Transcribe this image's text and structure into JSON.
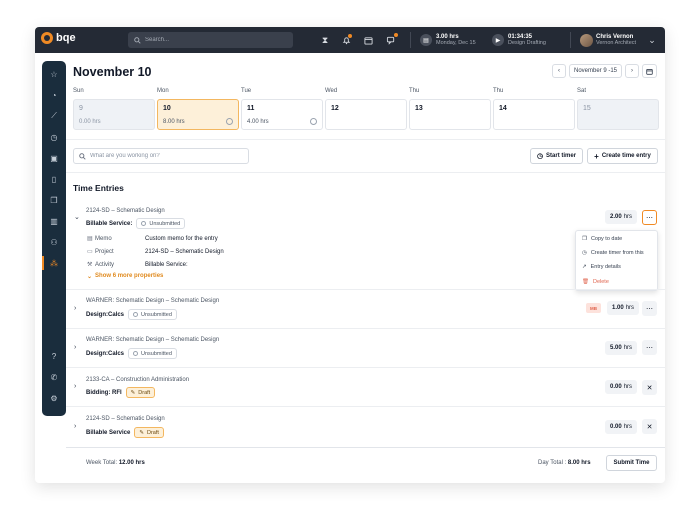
{
  "topbar": {
    "brand": "bqe",
    "search_placeholder": "Search...",
    "timer_hours": "3.00 hrs",
    "timer_date": "Monday, Dec 15",
    "running_time": "01:34:35",
    "running_activity": "Design Drafting",
    "user_name": "Chris Vernon",
    "user_role": "Vernon Architect"
  },
  "page": {
    "title": "November 10",
    "week_range": "November  9 -15"
  },
  "days": [
    {
      "label": "Sun",
      "num": "9",
      "hrs": "0.00 hrs",
      "state": "muted"
    },
    {
      "label": "Mon",
      "num": "10",
      "hrs": "8.00 hrs",
      "state": "selected"
    },
    {
      "label": "Tue",
      "num": "11",
      "hrs": "4.00 hrs",
      "state": "normal"
    },
    {
      "label": "Wed",
      "num": "12",
      "hrs": "",
      "state": "normal"
    },
    {
      "label": "Thu",
      "num": "13",
      "hrs": "",
      "state": "normal"
    },
    {
      "label": "Thu",
      "num": "14",
      "hrs": "",
      "state": "normal"
    },
    {
      "label": "Sat",
      "num": "15",
      "hrs": "",
      "state": "muted"
    }
  ],
  "actions": {
    "work_placeholder": "What are you working on?",
    "start_timer": "Start timer",
    "create_entry": "Create time entry"
  },
  "section_title": "Time Entries",
  "entries": [
    {
      "code": "2124-SD – Schematic Design",
      "service": "Billable Service:",
      "status": "Unsubmitted",
      "hours": "2.00",
      "unit": "hrs"
    },
    {
      "code": "WARNER: Schematic Design – Schematic Design",
      "service": "Design:Calcs",
      "status": "Unsubmitted",
      "hours": "1.00",
      "unit": "hrs",
      "initials": "MB"
    },
    {
      "code": "WARNER: Schematic Design – Schematic Design",
      "service": "Design:Calcs",
      "status": "Unsubmitted",
      "hours": "5.00",
      "unit": "hrs"
    },
    {
      "code": "2133-CA – Construction Administration",
      "service": "Bidding: RFI",
      "status": "Draft",
      "hours": "0.00",
      "unit": "hrs"
    },
    {
      "code": "2124-SD – Schematic Design",
      "service": "Billable Service",
      "status": "Draft",
      "hours": "0.00",
      "unit": "hrs"
    }
  ],
  "details": [
    {
      "label": "Memo",
      "value": "Custom memo for the entry"
    },
    {
      "label": "Project",
      "value": "2124-SD – Schematic Design"
    },
    {
      "label": "Activity",
      "value": "Billable Service:"
    }
  ],
  "more_properties": "Show 6 more properties",
  "menu": {
    "copy": "Copy to date",
    "timer": "Create timer from this",
    "details": "Entry details",
    "delete": "Delete"
  },
  "footer": {
    "week_label": "Week Total:",
    "week_value": "12.00 hrs",
    "day_label": "Day Total :",
    "day_value": "8.00 hrs",
    "submit": "Submit Time"
  }
}
